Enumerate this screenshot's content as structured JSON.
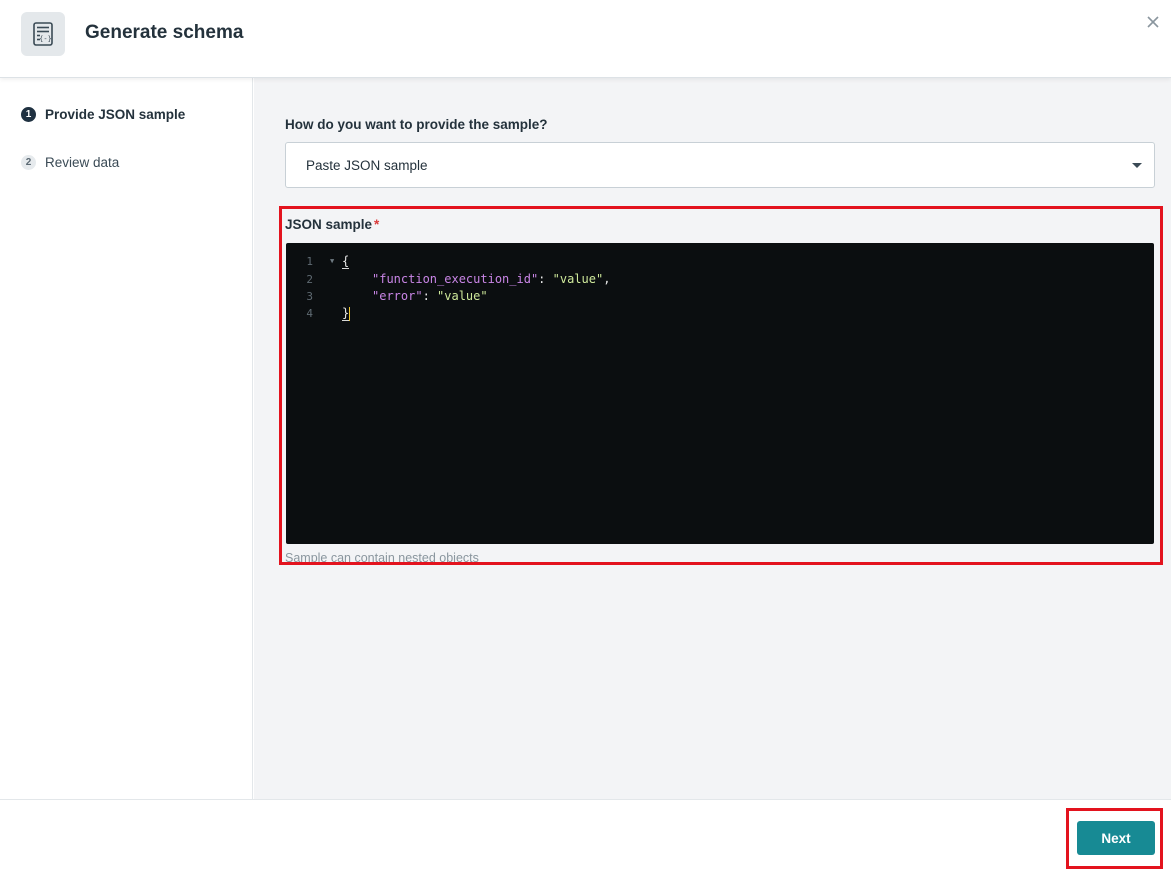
{
  "dialog": {
    "title": "Generate schema",
    "header_icon": "schema-document-icon",
    "close_icon": "close-icon"
  },
  "steps": [
    {
      "number": "1",
      "label": "Provide JSON sample",
      "active": true
    },
    {
      "number": "2",
      "label": "Review data",
      "active": false
    }
  ],
  "form": {
    "question_label": "How do you want to provide the sample?",
    "select_value": "Paste JSON sample",
    "json_label": "JSON sample",
    "required_marker": "*",
    "hint": "Sample can contain nested objects"
  },
  "editor": {
    "line_numbers": [
      "1",
      "2",
      "3",
      "4"
    ],
    "lines": [
      {
        "open_brace": "{"
      },
      {
        "key": "\"function_execution_id\"",
        "sep": ": ",
        "value": "\"value\"",
        "end": ","
      },
      {
        "key": "\"error\"",
        "sep": ": ",
        "value": "\"value\""
      },
      {
        "close_brace": "}"
      }
    ]
  },
  "footer": {
    "next_label": "Next"
  },
  "colors": {
    "accent": "#178a94",
    "highlight_box": "#e3131e",
    "editor_bg": "#0b0e10",
    "json_key": "#c985e6",
    "json_string": "#cfe99b"
  }
}
